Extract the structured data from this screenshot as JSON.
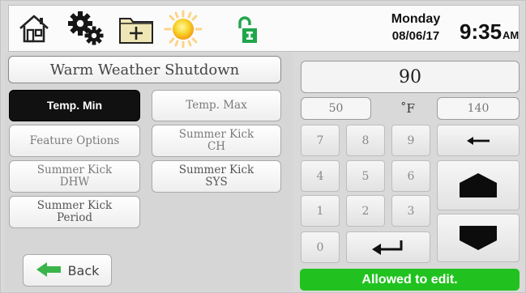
{
  "header": {
    "icons": [
      "home-icon",
      "settings-gears-icon",
      "add-folder-icon",
      "sun-icon",
      "unlock-icon"
    ],
    "day": "Monday",
    "date": "08/06/17",
    "time": "9:35",
    "ampm": "AM"
  },
  "menu": {
    "title": "Warm Weather Shutdown",
    "buttons": [
      {
        "label": "Temp. Min",
        "selected": true
      },
      {
        "label": "Temp. Max",
        "selected": false
      },
      {
        "label": "Feature Options",
        "selected": false
      },
      {
        "label": "Summer Kick CH",
        "line1": "Summer Kick",
        "line2": "CH",
        "selected": false
      },
      {
        "label": "Summer Kick DHW",
        "line1": "Summer Kick",
        "line2": "DHW",
        "selected": false
      },
      {
        "label": "Summer Kick SYS",
        "line1": "Summer Kick",
        "line2": "SYS",
        "selected": false
      },
      {
        "label": "Summer Kick Period",
        "line1": "Summer Kick",
        "line2": "Period",
        "selected": false
      }
    ],
    "back_label": "Back"
  },
  "editor": {
    "value": "90",
    "min": "50",
    "unit": "˚F",
    "max": "140",
    "keys": [
      "7",
      "8",
      "9",
      "4",
      "5",
      "6",
      "1",
      "2",
      "3",
      "0"
    ],
    "status": "Allowed to edit.",
    "colors": {
      "status_bg": "#21c21f",
      "selected_bg": "#111111"
    }
  }
}
